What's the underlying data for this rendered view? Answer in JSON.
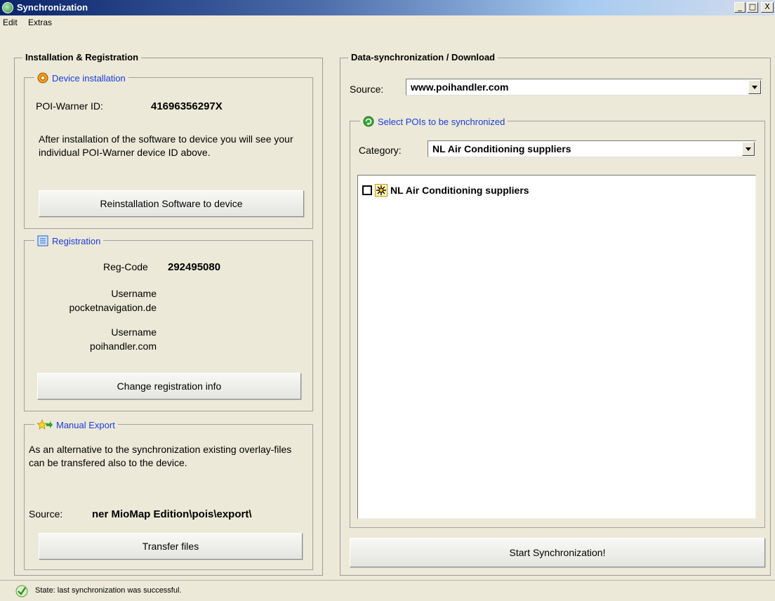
{
  "window": {
    "title": "Synchronization",
    "minimize_glyph": "_",
    "maximize_glyph": "□",
    "close_glyph": "X"
  },
  "menu": {
    "items": [
      "Edit",
      "Extras"
    ]
  },
  "left_panel": {
    "title": "Installation & Registration",
    "device_installation": {
      "title": "Device installation",
      "icon": "gear-icon",
      "id_label": "POI-Warner ID:",
      "id_value": "41696356297X",
      "description": "After installation of the software to device you will see your individual POI-Warner device ID above.",
      "button": "Reinstallation Software to device"
    },
    "registration": {
      "title": "Registration",
      "icon": "form-icon",
      "reg_code_label": "Reg-Code",
      "reg_code_value": "292495080",
      "username1_label": "Username",
      "username1_site": "pocketnavigation.de",
      "username2_label": "Username",
      "username2_site": "poihandler.com",
      "button": "Change registration info"
    },
    "manual_export": {
      "title": "Manual Export",
      "icon": "star-arrow-icon",
      "description": "As an alternative to the synchronization existing overlay-files can be transfered also to the device.",
      "source_label": "Source:",
      "source_value": "ner MioMap Edition\\pois\\export\\",
      "button": "Transfer files"
    }
  },
  "right_panel": {
    "title": "Data-synchronization / Download",
    "source_label": "Source:",
    "source_value": "www.poihandler.com",
    "select_group": {
      "title": "Select POIs to be synchronized",
      "icon": "refresh-icon",
      "category_label": "Category:",
      "category_value": "NL Air Conditioning suppliers",
      "items": [
        {
          "label": "NL Air Conditioning suppliers",
          "checked": false,
          "icon": "sun-icon"
        }
      ]
    },
    "button": "Start Synchronization!"
  },
  "status": {
    "icon": "check-icon",
    "text": "State: last synchronization was successful."
  },
  "colors": {
    "group_title": "#1a3ae0",
    "face": "#ece9d8",
    "titlebar_start": "#0a246a"
  }
}
